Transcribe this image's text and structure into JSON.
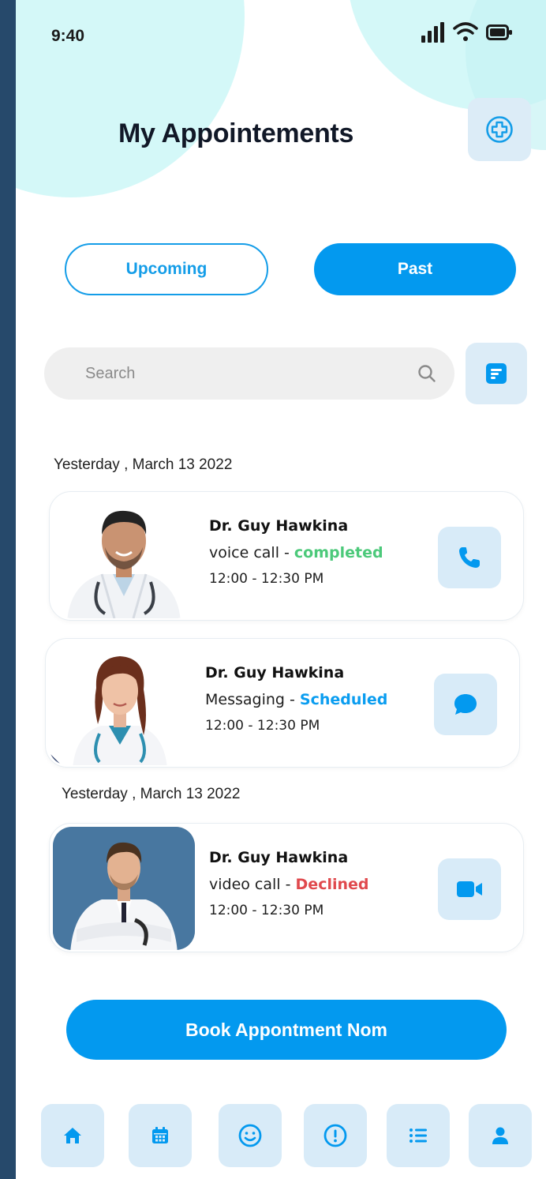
{
  "status_bar": {
    "time": "9:40"
  },
  "header": {
    "title": "My Appointements"
  },
  "tabs": [
    {
      "label": "Upcoming",
      "active": false
    },
    {
      "label": "Past",
      "active": true
    }
  ],
  "search": {
    "placeholder": "Search",
    "value": ""
  },
  "groups": [
    {
      "date": "Yesterday , March 13 2022"
    },
    {
      "date": "Yesterday , March 13 2022"
    }
  ],
  "appointments": [
    {
      "doctor": "Dr. Guy Hawkina",
      "type": "voice call -",
      "status": "completed",
      "status_color": "#4cc97a",
      "time": "12:00 - 12:30 PM",
      "action_icon": "phone-icon"
    },
    {
      "doctor": "Dr. Guy Hawkina",
      "type": "Messaging -",
      "status": "Scheduled",
      "status_color": "#0a9df0",
      "time": "12:00 - 12:30 PM",
      "action_icon": "chat-icon"
    },
    {
      "doctor": "Dr. Guy Hawkina",
      "type": "video call -",
      "status": "Declined",
      "status_color": "#e0494d",
      "time": "12:00 - 12:30 PM",
      "action_icon": "video-icon"
    }
  ],
  "book_button": {
    "label": "Book Appontment Nom"
  },
  "bottom_nav": [
    "home-icon",
    "calendar-icon",
    "smile-icon",
    "alert-icon",
    "list-icon",
    "profile-icon"
  ],
  "colors": {
    "accent": "#0399ef",
    "tile": "#d8ebf8",
    "bubble": "#d4f8f8",
    "frame": "#26496b"
  }
}
